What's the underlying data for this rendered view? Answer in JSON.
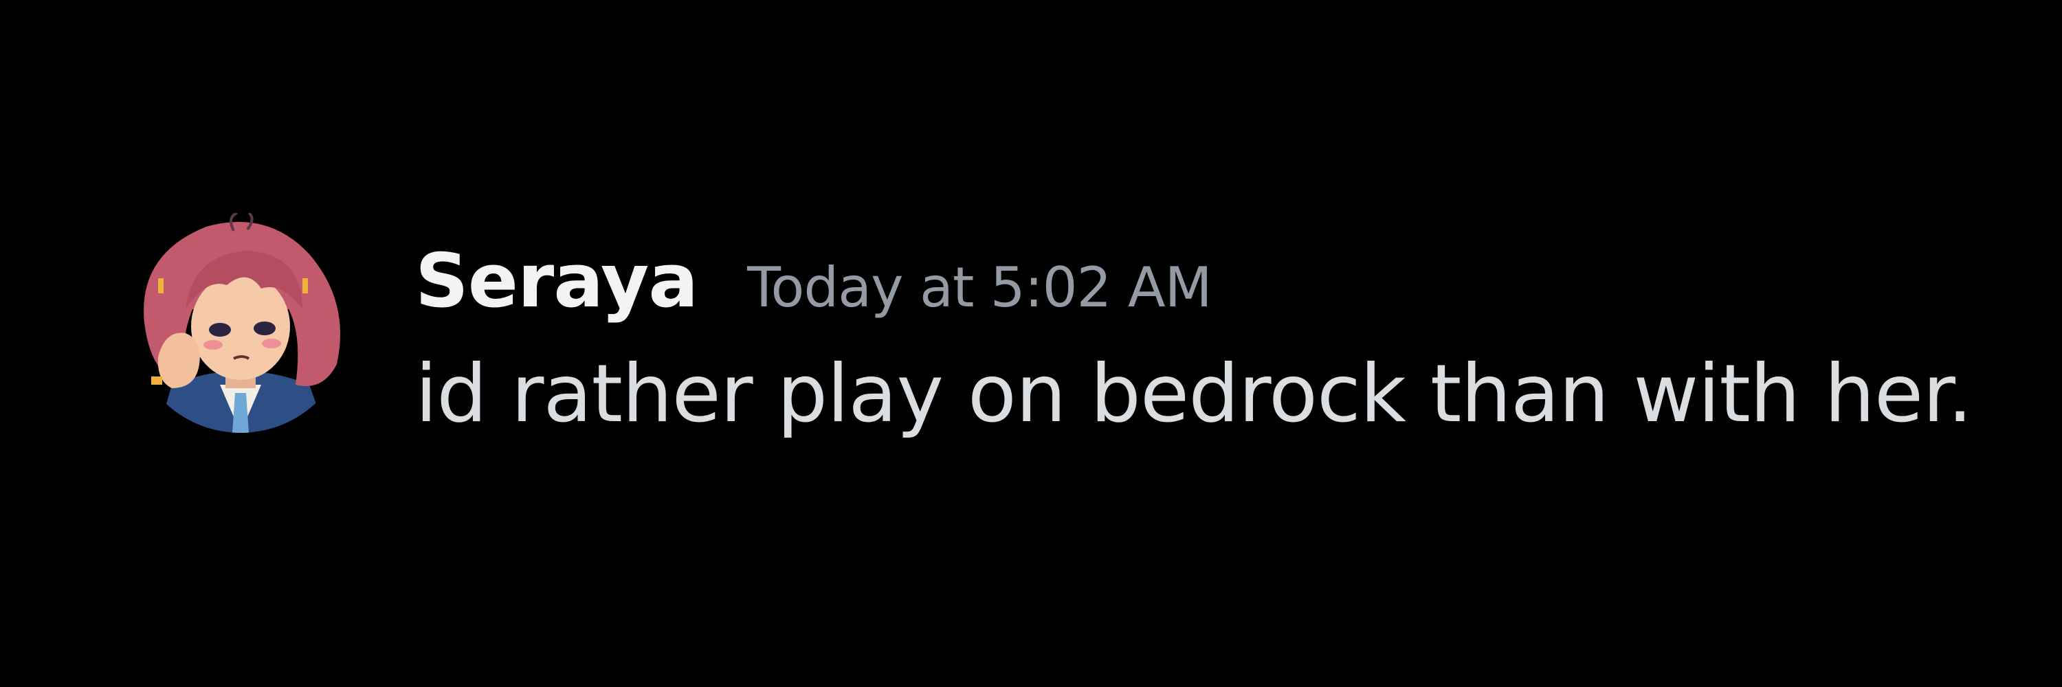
{
  "message": {
    "author": "Seraya",
    "timestamp": "Today at 5:02 AM",
    "content": "id rather play on bedrock than with her."
  },
  "avatar": {
    "icon": "user-avatar",
    "colors": {
      "hair": "#c25a6b",
      "skin": "#f6c9a9",
      "jacket": "#2d4f86",
      "tie": "#6fa8d6",
      "accent": "#f0b23c"
    }
  },
  "colors": {
    "background": "#000000",
    "username": "#f2f3f5",
    "timestamp": "#949ba4",
    "content": "#dbdee1"
  }
}
